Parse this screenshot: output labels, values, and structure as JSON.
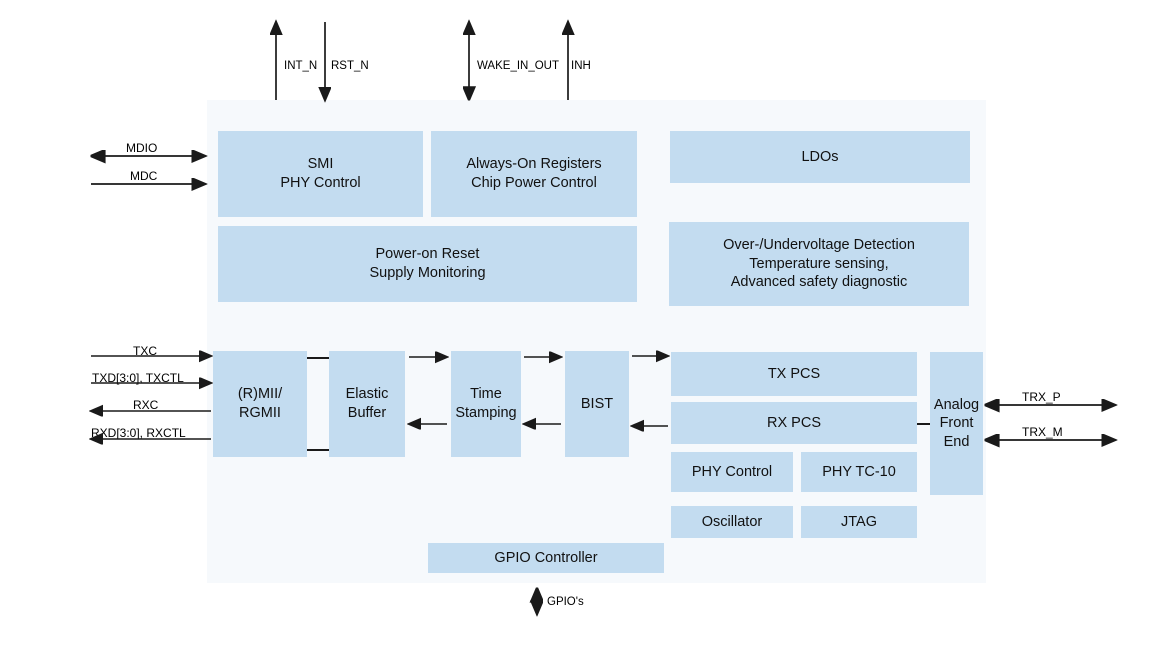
{
  "diagram": {
    "title": "Ethernet PHY block diagram",
    "chip_fill": "#f6f9fc",
    "block_fill": "#c3dcf0",
    "line_color": "#1a1a1a"
  },
  "top_signals": [
    {
      "label": "INT_N",
      "direction": "up"
    },
    {
      "label": "RST_N",
      "direction": "down"
    },
    {
      "label": "WAKE_IN_OUT",
      "direction": "both"
    },
    {
      "label": "INH",
      "direction": "up"
    }
  ],
  "left_signals_upper": [
    {
      "label": "MDIO",
      "direction": "both"
    },
    {
      "label": "MDC",
      "direction": "right"
    }
  ],
  "left_signals_lower": [
    {
      "label": "TXC",
      "direction": "right"
    },
    {
      "label": "TXD[3:0], TXCTL",
      "direction": "right"
    },
    {
      "label": "RXC",
      "direction": "left"
    },
    {
      "label": "RXD[3:0], RXCTL",
      "direction": "left"
    }
  ],
  "right_signals": [
    {
      "label": "TRX_P",
      "direction": "both"
    },
    {
      "label": "TRX_M",
      "direction": "both"
    }
  ],
  "bottom_signals": [
    {
      "label": "GPIO's",
      "direction": "both"
    }
  ],
  "blocks": {
    "smi": {
      "label": "SMI\nPHY Control"
    },
    "always_on": {
      "label": "Always-On Registers\nChip Power Control"
    },
    "ldos": {
      "label": "LDOs"
    },
    "por": {
      "label": "Power-on Reset\nSupply Monitoring"
    },
    "safety": {
      "label": "Over-/Undervoltage Detection\nTemperature sensing,\nAdvanced safety diagnostic"
    },
    "mii": {
      "label": "(R)MII/ RGMII"
    },
    "elastic": {
      "label": "Elastic\nBuffer"
    },
    "timestamp": {
      "label": "Time\nStamping"
    },
    "bist": {
      "label": "BIST"
    },
    "tx_pcs": {
      "label": "TX PCS"
    },
    "rx_pcs": {
      "label": "RX PCS"
    },
    "phy_control": {
      "label": "PHY Control"
    },
    "phy_tc10": {
      "label": "PHY TC-10"
    },
    "oscillator": {
      "label": "Oscillator"
    },
    "jtag": {
      "label": "JTAG"
    },
    "afe": {
      "label": "Analog\nFront\nEnd"
    },
    "gpio": {
      "label": "GPIO Controller"
    }
  }
}
